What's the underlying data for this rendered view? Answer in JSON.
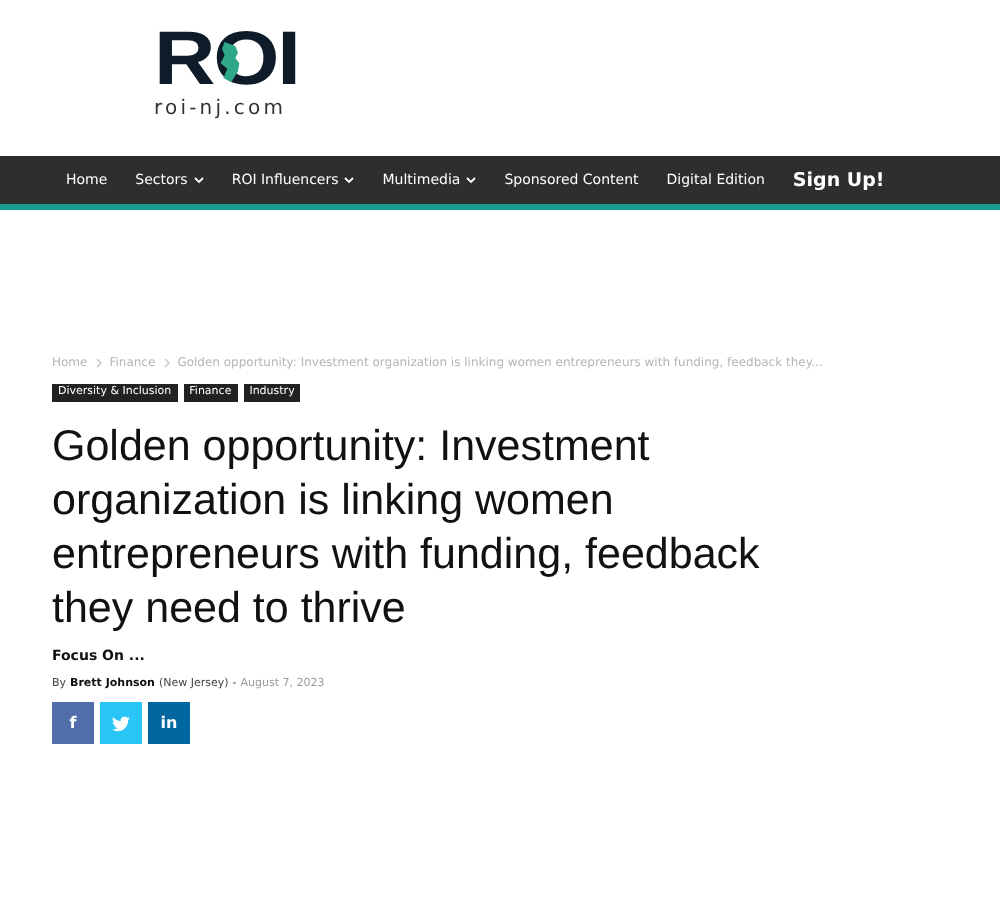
{
  "logo": {
    "wordmark": "ROI",
    "domain": "roi-nj.com"
  },
  "nav": [
    {
      "label": "Home",
      "dropdown": false,
      "emphasis": false
    },
    {
      "label": "Sectors",
      "dropdown": true,
      "emphasis": false
    },
    {
      "label": "ROI Influencers",
      "dropdown": true,
      "emphasis": false
    },
    {
      "label": "Multimedia",
      "dropdown": true,
      "emphasis": false
    },
    {
      "label": "Sponsored Content",
      "dropdown": false,
      "emphasis": false
    },
    {
      "label": "Digital Edition",
      "dropdown": false,
      "emphasis": false
    },
    {
      "label": "Sign Up!",
      "dropdown": false,
      "emphasis": true
    }
  ],
  "breadcrumb": [
    "Home",
    "Finance",
    "Golden opportunity: Investment organization is linking women entrepreneurs with funding, feedback they..."
  ],
  "tags": [
    "Diversity & Inclusion",
    "Finance",
    "Industry"
  ],
  "headline": "Golden opportunity: Investment organization is linking women entrepreneurs with funding, feedback they need to thrive",
  "column": "Focus On ...",
  "byline": {
    "prefix": "By",
    "author": "Brett Johnson",
    "location": "(New Jersey)",
    "separator": "-",
    "date": "August 7, 2023"
  },
  "share": [
    {
      "kind": "facebook",
      "label": "f"
    },
    {
      "kind": "twitter"
    },
    {
      "kind": "linkedin",
      "label": "in"
    }
  ]
}
